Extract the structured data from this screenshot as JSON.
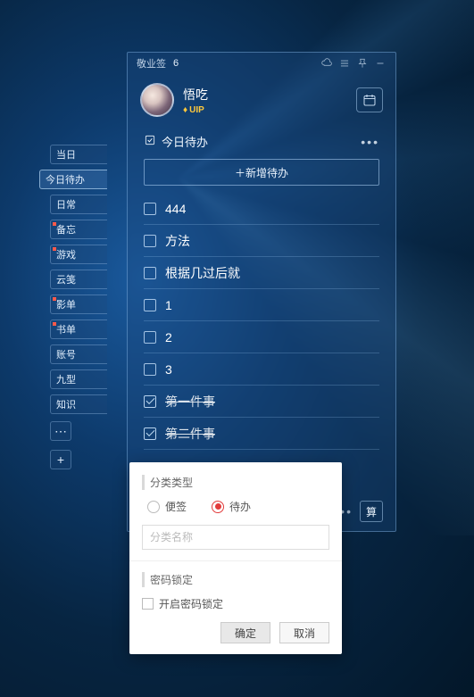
{
  "titlebar": {
    "app_name": "敬业签",
    "notification_count": "6"
  },
  "profile": {
    "username": "悟吃",
    "vip_label": "UIP"
  },
  "section": {
    "title": "今日待办",
    "add_button": "＋新增待办"
  },
  "todos": [
    {
      "label": "444",
      "done": false
    },
    {
      "label": "方法",
      "done": false
    },
    {
      "label": "根据几过后就",
      "done": false
    },
    {
      "label": "1",
      "done": false
    },
    {
      "label": "2",
      "done": false
    },
    {
      "label": "3",
      "done": false
    },
    {
      "label": "第一件事",
      "done": true
    },
    {
      "label": "第二件事",
      "done": true
    }
  ],
  "side_tabs": [
    {
      "label": "当日",
      "marked": false,
      "active": false
    },
    {
      "label": "今日待办",
      "marked": false,
      "active": true
    },
    {
      "label": "日常",
      "marked": false,
      "active": false
    },
    {
      "label": "备忘",
      "marked": true,
      "active": false
    },
    {
      "label": "游戏",
      "marked": true,
      "active": false
    },
    {
      "label": "云笺",
      "marked": false,
      "active": false
    },
    {
      "label": "影单",
      "marked": true,
      "active": false
    },
    {
      "label": "书单",
      "marked": true,
      "active": false
    },
    {
      "label": "账号",
      "marked": false,
      "active": false
    },
    {
      "label": "九型",
      "marked": false,
      "active": false
    },
    {
      "label": "知识",
      "marked": false,
      "active": false
    }
  ],
  "bottom": {
    "calc_label": "算"
  },
  "dialog": {
    "type_label": "分类类型",
    "radio_note": "便签",
    "radio_todo": "待办",
    "name_placeholder": "分类名称",
    "lock_label": "密码锁定",
    "lock_checkbox": "开启密码锁定",
    "ok": "确定",
    "cancel": "取消"
  }
}
